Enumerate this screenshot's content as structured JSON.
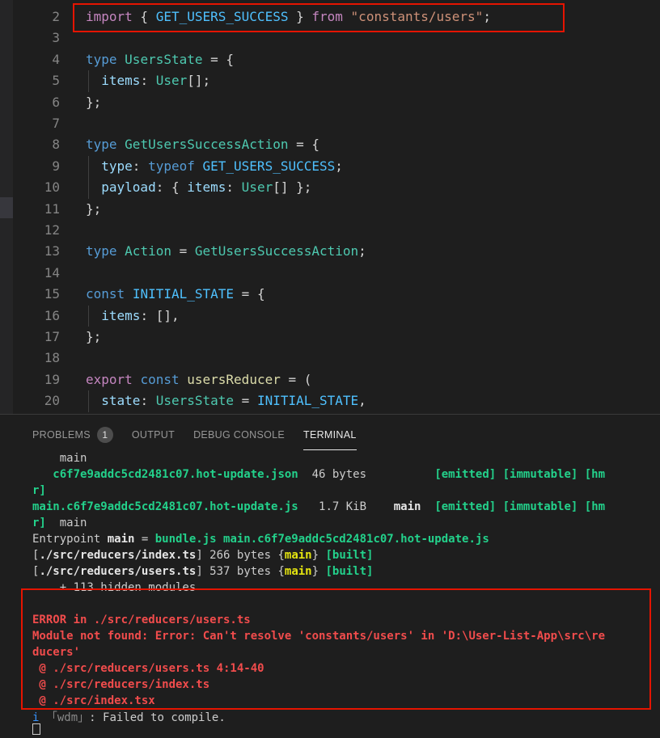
{
  "editor": {
    "lines": [
      {
        "n": "2",
        "tokens": [
          [
            "kw2",
            "import"
          ],
          [
            "p",
            " { "
          ],
          [
            "co",
            "GET_USERS_SUCCESS"
          ],
          [
            "p",
            " } "
          ],
          [
            "kw2",
            "from"
          ],
          [
            "p",
            " "
          ],
          [
            "st",
            "\"constants/users\""
          ],
          [
            "p",
            ";"
          ]
        ]
      },
      {
        "n": "3",
        "tokens": []
      },
      {
        "n": "4",
        "tokens": [
          [
            "kw",
            "type"
          ],
          [
            "p",
            " "
          ],
          [
            "ty",
            "UsersState"
          ],
          [
            "p",
            " = {"
          ]
        ]
      },
      {
        "n": "5",
        "guide": true,
        "tokens": [
          [
            "p",
            "  "
          ],
          [
            "va",
            "items"
          ],
          [
            "p",
            ": "
          ],
          [
            "ty",
            "User"
          ],
          [
            "p",
            "[];"
          ]
        ]
      },
      {
        "n": "6",
        "tokens": [
          [
            "p",
            "};"
          ]
        ]
      },
      {
        "n": "7",
        "tokens": []
      },
      {
        "n": "8",
        "tokens": [
          [
            "kw",
            "type"
          ],
          [
            "p",
            " "
          ],
          [
            "ty",
            "GetUsersSuccessAction"
          ],
          [
            "p",
            " = {"
          ]
        ]
      },
      {
        "n": "9",
        "guide": true,
        "tokens": [
          [
            "p",
            "  "
          ],
          [
            "va",
            "type"
          ],
          [
            "p",
            ": "
          ],
          [
            "kw",
            "typeof"
          ],
          [
            "p",
            " "
          ],
          [
            "co",
            "GET_USERS_SUCCESS"
          ],
          [
            "p",
            ";"
          ]
        ]
      },
      {
        "n": "10",
        "guide": true,
        "tokens": [
          [
            "p",
            "  "
          ],
          [
            "va",
            "payload"
          ],
          [
            "p",
            ": { "
          ],
          [
            "va",
            "items"
          ],
          [
            "p",
            ": "
          ],
          [
            "ty",
            "User"
          ],
          [
            "p",
            "[] };"
          ]
        ]
      },
      {
        "n": "11",
        "tokens": [
          [
            "p",
            "};"
          ]
        ]
      },
      {
        "n": "12",
        "tokens": []
      },
      {
        "n": "13",
        "tokens": [
          [
            "kw",
            "type"
          ],
          [
            "p",
            " "
          ],
          [
            "ty",
            "Action"
          ],
          [
            "p",
            " = "
          ],
          [
            "ty",
            "GetUsersSuccessAction"
          ],
          [
            "p",
            ";"
          ]
        ]
      },
      {
        "n": "14",
        "tokens": []
      },
      {
        "n": "15",
        "tokens": [
          [
            "kw",
            "const"
          ],
          [
            "p",
            " "
          ],
          [
            "co",
            "INITIAL_STATE"
          ],
          [
            "p",
            " = {"
          ]
        ]
      },
      {
        "n": "16",
        "guide": true,
        "tokens": [
          [
            "p",
            "  "
          ],
          [
            "va",
            "items"
          ],
          [
            "p",
            ": [],"
          ]
        ]
      },
      {
        "n": "17",
        "tokens": [
          [
            "p",
            "};"
          ]
        ]
      },
      {
        "n": "18",
        "tokens": []
      },
      {
        "n": "19",
        "tokens": [
          [
            "kw2",
            "export"
          ],
          [
            "p",
            " "
          ],
          [
            "kw",
            "const"
          ],
          [
            "p",
            " "
          ],
          [
            "fn",
            "usersReducer"
          ],
          [
            "p",
            " = ("
          ]
        ]
      },
      {
        "n": "20",
        "guide": true,
        "tokens": [
          [
            "p",
            "  "
          ],
          [
            "va",
            "state"
          ],
          [
            "p",
            ": "
          ],
          [
            "ty",
            "UsersState"
          ],
          [
            "p",
            " = "
          ],
          [
            "co",
            "INITIAL_STATE"
          ],
          [
            "p",
            ","
          ]
        ]
      }
    ]
  },
  "panel": {
    "tabs": {
      "problems": "PROBLEMS",
      "problems_count": "1",
      "output": "OUTPUT",
      "debug_console": "DEBUG CONSOLE",
      "terminal": "TERMINAL"
    },
    "terminal_lines": [
      [
        [
          "p",
          "    main"
        ]
      ],
      [
        [
          "p",
          "   "
        ],
        [
          "g",
          "c6f7e9addc5cd2481c07.hot-update.json"
        ],
        [
          "p",
          "  46 bytes          "
        ],
        [
          "g",
          "[emitted] [immutable] [hm"
        ]
      ],
      [
        [
          "g",
          "r]"
        ]
      ],
      [
        [
          "g",
          "main.c6f7e9addc5cd2481c07.hot-update.js"
        ],
        [
          "p",
          "   1.7 KiB    "
        ],
        [
          "w",
          "main"
        ],
        [
          "p",
          "  "
        ],
        [
          "g",
          "[emitted] [immutable] [hm"
        ]
      ],
      [
        [
          "g",
          "r]"
        ],
        [
          "p",
          "  main"
        ]
      ],
      [
        [
          "p",
          "Entrypoint "
        ],
        [
          "w",
          "main"
        ],
        [
          "p",
          " = "
        ],
        [
          "g",
          "bundle.js main.c6f7e9addc5cd2481c07.hot-update.js"
        ]
      ],
      [
        [
          "p",
          "["
        ],
        [
          "w",
          "./src/reducers/index.ts"
        ],
        [
          "p",
          "] 266 bytes {"
        ],
        [
          "y",
          "main"
        ],
        [
          "p",
          "} "
        ],
        [
          "g",
          "[built]"
        ]
      ],
      [
        [
          "p",
          "["
        ],
        [
          "w",
          "./src/reducers/users.ts"
        ],
        [
          "p",
          "] 537 bytes {"
        ],
        [
          "y",
          "main"
        ],
        [
          "p",
          "} "
        ],
        [
          "g",
          "[built]"
        ]
      ],
      [
        [
          "p",
          "    + 113 hidden modules"
        ]
      ],
      [],
      [
        [
          "r",
          "ERROR in ./src/reducers/users.ts"
        ]
      ],
      [
        [
          "r",
          "Module not found: Error: Can't resolve 'constants/users' in 'D:\\User-List-App\\src\\re"
        ]
      ],
      [
        [
          "r",
          "ducers'"
        ]
      ],
      [
        [
          "r",
          " @ ./src/reducers/users.ts 4:14-40"
        ]
      ],
      [
        [
          "r",
          " @ ./src/reducers/index.ts"
        ]
      ],
      [
        [
          "r",
          " @ ./src/index.tsx"
        ]
      ]
    ],
    "info_icon": "i",
    "info_prefix": "「wdm」",
    "info_text": ": Failed to compile."
  },
  "colors": {
    "highlight_border": "#e51400",
    "terminal_green": "#23d18b",
    "terminal_red": "#f14c4c",
    "terminal_yellow": "#e5e510"
  }
}
